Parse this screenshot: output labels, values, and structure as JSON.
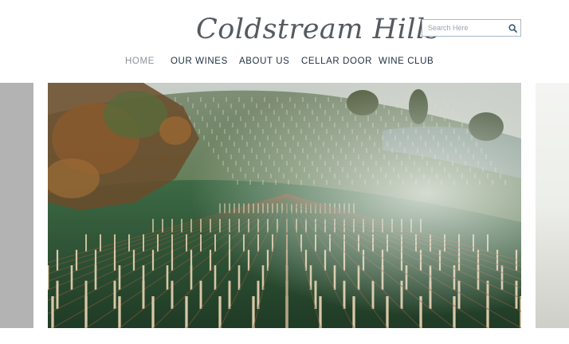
{
  "brand": {
    "logo_text": "Coldstream Hills"
  },
  "search": {
    "placeholder": "Search Here",
    "icon": "magnifier"
  },
  "nav": {
    "items": [
      {
        "label": "HOME",
        "active": true
      },
      {
        "label": "OUR WINES",
        "active": false
      },
      {
        "label": "ABOUT US",
        "active": false
      },
      {
        "label": "CELLAR DOOR",
        "active": false
      },
      {
        "label": "WINE CLUB",
        "active": false
      }
    ]
  },
  "colors": {
    "nav_text": "#1f2f40",
    "nav_active": "#8c9499",
    "search_border": "#a9bac6"
  }
}
